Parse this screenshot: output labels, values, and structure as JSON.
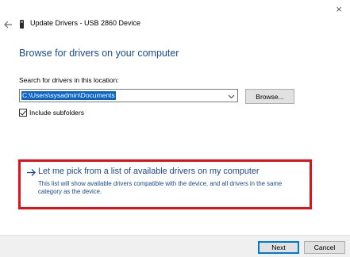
{
  "window": {
    "close_glyph": "×",
    "title": "Update Drivers - USB 2860 Device",
    "back_icon": "back-arrow-icon",
    "device_icon": "usb-device-icon"
  },
  "main": {
    "heading": "Browse for drivers on your computer",
    "search_label": "Search for drivers in this location:",
    "path_value": "C:\\Users\\sysadmin\\Documents",
    "browse_label": "Browse...",
    "include_subfolders_label": "Include subfolders",
    "include_subfolders_checked": true
  },
  "pick_option": {
    "title": "Let me pick from a list of available drivers on my computer",
    "description": "This list will show available drivers compatible with the device, and all drivers in the same category as the device.",
    "highlight_color": "#e3101a",
    "link_color": "#1a4a8f"
  },
  "footer": {
    "next_label": "Next",
    "cancel_label": "Cancel"
  }
}
